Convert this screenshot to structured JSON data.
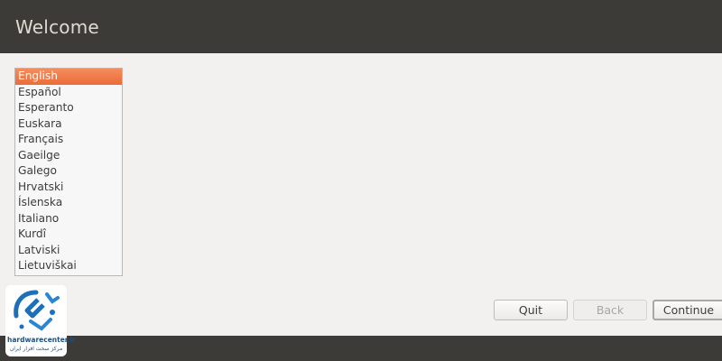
{
  "window": {
    "title": "Welcome"
  },
  "languages": {
    "selected_index": 0,
    "items": [
      "English",
      "Español",
      "Esperanto",
      "Euskara",
      "Français",
      "Gaeilge",
      "Galego",
      "Hrvatski",
      "Íslenska",
      "Italiano",
      "Kurdî",
      "Latviski",
      "Lietuviškai"
    ]
  },
  "buttons": {
    "quit": "Quit",
    "back": "Back",
    "continue": "Continue"
  },
  "watermark": {
    "brand": "hardwarecenter.ir",
    "subtitle": "مرکز سخت افزار ایران"
  },
  "colors": {
    "title_bar": "#3c3b37",
    "selection": "#ec6b38",
    "background": "#f2f1f0",
    "logo_blue": "#1d6fb8"
  }
}
